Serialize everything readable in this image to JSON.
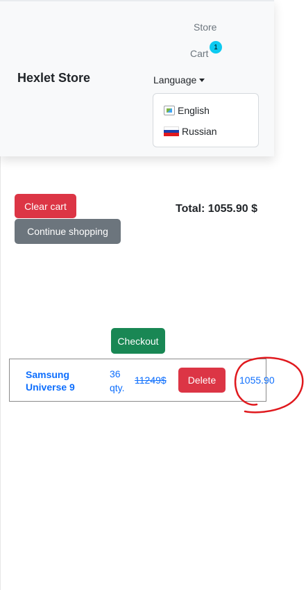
{
  "navbar": {
    "brand": "Hexlet Store",
    "links": {
      "store": "Store",
      "cart": "Cart"
    },
    "cart_badge": "1",
    "language_toggle": "Language",
    "languages": [
      {
        "label": "English",
        "icon": "broken-image-icon"
      },
      {
        "label": "Russian",
        "icon": "russia-flag-icon"
      }
    ]
  },
  "actions": {
    "clear_cart": "Clear cart",
    "continue_shopping": "Continue shopping",
    "checkout": "Checkout"
  },
  "summary": {
    "total": "Total: 1055.90 $"
  },
  "cart": {
    "items": [
      {
        "name": "Samsung Universe 9",
        "qty": "36 qty.",
        "old_price": "11249$",
        "delete": "Delete",
        "line_total": "1055.90"
      }
    ]
  },
  "colors": {
    "danger": "#dc3545",
    "secondary": "#6c757d",
    "success": "#198754",
    "link": "#0d6efd",
    "badge": "#0dcaf0",
    "annotation": "#e0191e"
  }
}
